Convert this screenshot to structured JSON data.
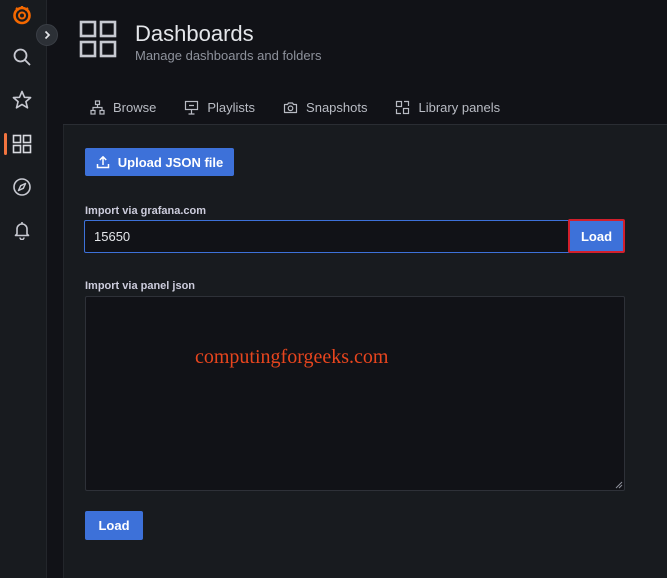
{
  "sidebar": {
    "items": [
      {
        "name": "grafana-logo",
        "color": "#f46800"
      },
      {
        "name": "search-icon"
      },
      {
        "name": "star-icon"
      },
      {
        "name": "dashboards-icon",
        "active": true
      },
      {
        "name": "compass-icon"
      },
      {
        "name": "bell-icon"
      }
    ],
    "active_color": "#f2743f"
  },
  "header": {
    "title": "Dashboards",
    "subtitle": "Manage dashboards and folders"
  },
  "tabs": [
    {
      "label": "Browse",
      "icon": "sitemap-icon"
    },
    {
      "label": "Playlists",
      "icon": "presentation-icon"
    },
    {
      "label": "Snapshots",
      "icon": "camera-icon"
    },
    {
      "label": "Library panels",
      "icon": "library-panels-icon"
    }
  ],
  "import": {
    "upload_label": "Upload JSON file",
    "grafana_com_label": "Import via grafana.com",
    "grafana_com_value": "15650",
    "load_label": "Load",
    "panel_json_label": "Import via panel json",
    "panel_json_value": "",
    "bottom_load_label": "Load"
  },
  "watermark": "computingforgeeks.com",
  "colors": {
    "primary": "#3d71d9",
    "highlight_border": "#d21f2c",
    "watermark": "#e8451e"
  }
}
